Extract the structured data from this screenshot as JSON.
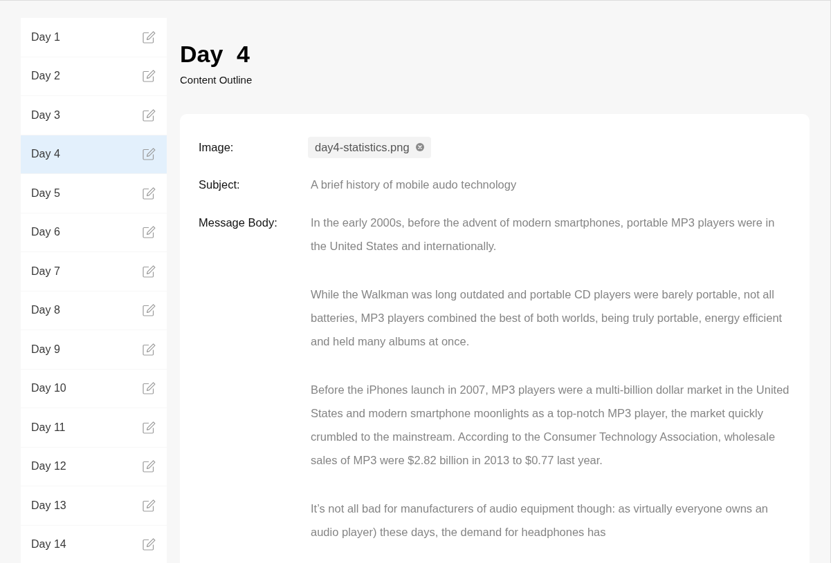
{
  "sidebar": {
    "items": [
      {
        "label": "Day 1",
        "selected": false
      },
      {
        "label": "Day 2",
        "selected": false
      },
      {
        "label": "Day 3",
        "selected": false
      },
      {
        "label": "Day 4",
        "selected": true
      },
      {
        "label": "Day 5",
        "selected": false
      },
      {
        "label": "Day 6",
        "selected": false
      },
      {
        "label": "Day 7",
        "selected": false
      },
      {
        "label": "Day 8",
        "selected": false
      },
      {
        "label": "Day 9",
        "selected": false
      },
      {
        "label": "Day 10",
        "selected": false
      },
      {
        "label": "Day 11",
        "selected": false
      },
      {
        "label": "Day 12",
        "selected": false
      },
      {
        "label": "Day 13",
        "selected": false
      },
      {
        "label": "Day 14",
        "selected": false
      }
    ]
  },
  "header": {
    "title": "Day 4",
    "subtitle": "Content Outline"
  },
  "form": {
    "fields": [
      {
        "kind": "attachment",
        "label": "Image:",
        "value": "day4-statistics.png"
      },
      {
        "kind": "text",
        "label": "Subject:",
        "value": "A brief history of mobile audo technology"
      },
      {
        "kind": "paragraphs",
        "label": "Message Body:",
        "paragraphs": [
          "In the early 2000s, before the advent of modern smartphones, portable MP3 players were in the United States and internationally.",
          "While the Walkman was long outdated and portable CD players were barely portable, not all batteries, MP3 players combined the best of both worlds, being truly portable, energy efficient and held many albums at once.",
          "Before the iPhones launch in 2007, MP3 players were a multi-billion dollar market in the United States and modern smartphone moonlights as a top-notch MP3 player, the market quickly crumbled to the mainstream. According to the Consumer Technology Association, wholesale sales of MP3 were $2.82 billion in 2013 to $0.77 last year.",
          "It’s not all bad for manufacturers of audio equipment though: as virtually everyone owns an audio player) these days, the demand for headphones has"
        ]
      }
    ]
  }
}
